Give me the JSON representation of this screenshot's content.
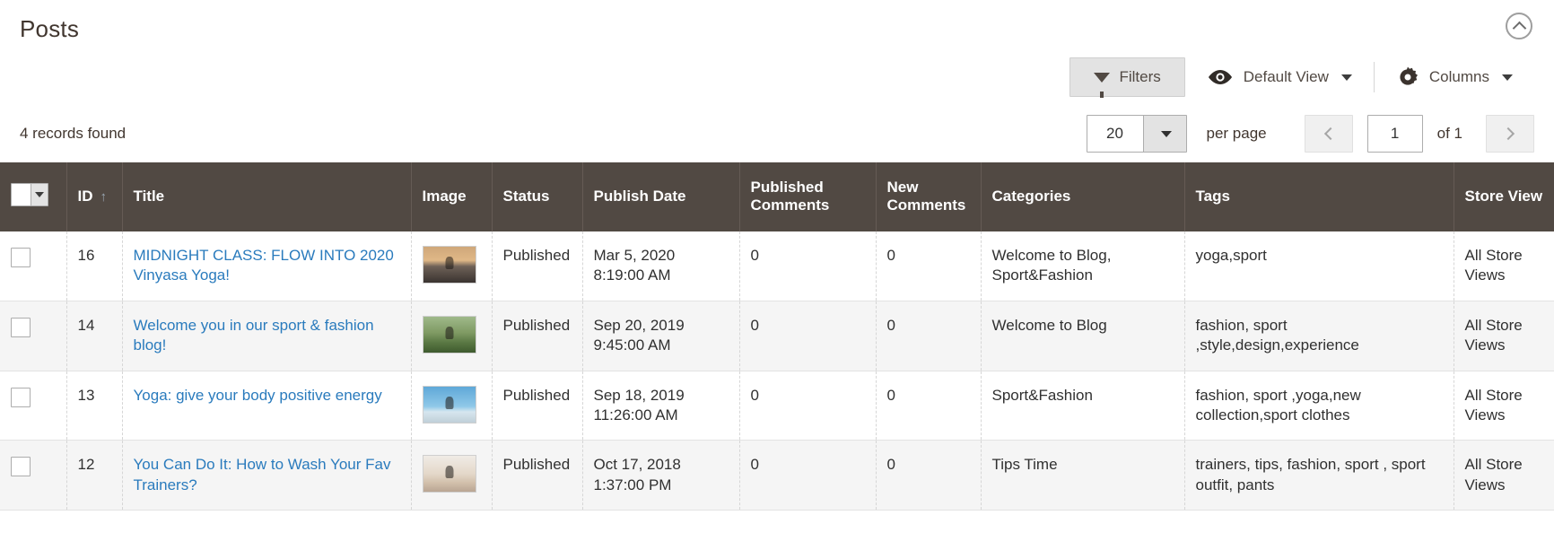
{
  "header": {
    "title": "Posts",
    "collapse_icon": "chevron-up-circle-icon"
  },
  "toolbar": {
    "filters_label": "Filters",
    "filters_icon": "funnel-icon",
    "view_label": "Default View",
    "view_icon": "eye-icon",
    "columns_label": "Columns",
    "columns_icon": "gear-icon",
    "caret_icon": "chevron-down-icon"
  },
  "pagination": {
    "records_found": "4 records found",
    "per_page_value": "20",
    "per_page_label": "per page",
    "current_page": "1",
    "of_label": "of 1",
    "prev_icon": "chevron-left-icon",
    "next_icon": "chevron-right-icon"
  },
  "grid": {
    "select_all_icon": "checkbox-dropdown-icon",
    "sort_indicator": "↑",
    "columns": [
      {
        "key": "check",
        "label": ""
      },
      {
        "key": "id",
        "label": "ID"
      },
      {
        "key": "title",
        "label": "Title"
      },
      {
        "key": "image",
        "label": "Image"
      },
      {
        "key": "status",
        "label": "Status"
      },
      {
        "key": "date",
        "label": "Publish Date"
      },
      {
        "key": "pcomm",
        "label": "Published Comments"
      },
      {
        "key": "ncomm",
        "label": "New Comments"
      },
      {
        "key": "cats",
        "label": "Categories"
      },
      {
        "key": "tags",
        "label": "Tags"
      },
      {
        "key": "store",
        "label": "Store View"
      }
    ],
    "rows": [
      {
        "id": "16",
        "title": "MIDNIGHT CLASS: FLOW INTO 2020 Vinyasa Yoga!",
        "image_alt": "yoga-sunset-thumbnail",
        "status": "Published",
        "publish_date": "Mar 5, 2020 8:19:00 AM",
        "published_comments": "0",
        "new_comments": "0",
        "categories": "Welcome to Blog, Sport&Fashion",
        "tags": "yoga,sport",
        "store_view": "All Store Views"
      },
      {
        "id": "14",
        "title": "Welcome you in our sport & fashion blog!",
        "image_alt": "cyclists-thumbnail",
        "status": "Published",
        "publish_date": "Sep 20, 2019 9:45:00 AM",
        "published_comments": "0",
        "new_comments": "0",
        "categories": "Welcome to Blog",
        "tags": "fashion, sport ,style,design,experience",
        "store_view": "All Store Views"
      },
      {
        "id": "13",
        "title": "Yoga: give your body positive energy",
        "image_alt": "yoga-beach-thumbnail",
        "status": "Published",
        "publish_date": "Sep 18, 2019 11:26:00 AM",
        "published_comments": "0",
        "new_comments": "0",
        "categories": "Sport&Fashion",
        "tags": "fashion, sport ,yoga,new collection,sport clothes",
        "store_view": "All Store Views"
      },
      {
        "id": "12",
        "title": "You Can Do It: How to Wash Your Fav Trainers?",
        "image_alt": "trainers-thumbnail",
        "status": "Published",
        "publish_date": "Oct 17, 2018 1:37:00 PM",
        "published_comments": "0",
        "new_comments": "0",
        "categories": "Tips Time",
        "tags": "trainers, tips, fashion, sport , sport outfit, pants",
        "store_view": "All Store Views"
      }
    ]
  },
  "colors": {
    "header_bg": "#514943",
    "link": "#2a7bbd",
    "status_published": "#5a7d5a",
    "title_text": "#41362f"
  }
}
